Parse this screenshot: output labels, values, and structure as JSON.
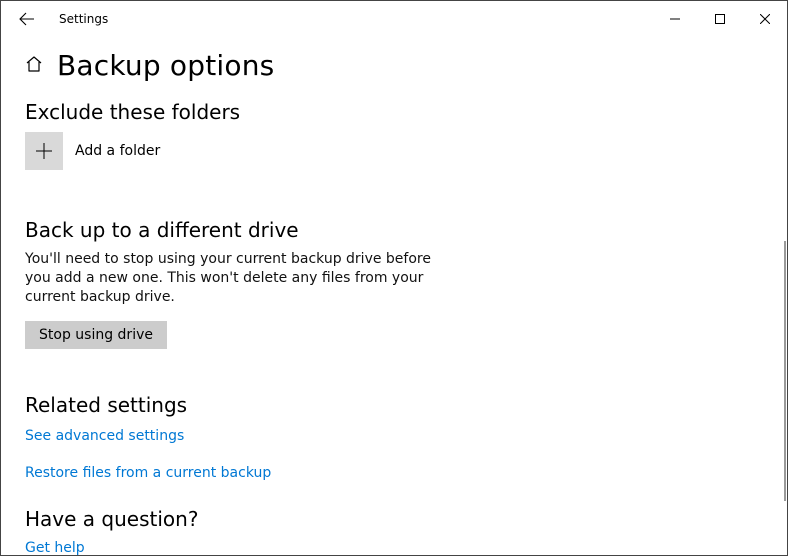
{
  "window": {
    "title": "Settings"
  },
  "page": {
    "heading": "Backup options"
  },
  "exclude": {
    "heading": "Exclude these folders",
    "add_label": "Add a folder"
  },
  "different_drive": {
    "heading": "Back up to a different drive",
    "body": "You'll need to stop using your current backup drive before you add a new one. This won't delete any files from your current backup drive.",
    "button": "Stop using drive"
  },
  "related": {
    "heading": "Related settings",
    "advanced_link": "See advanced settings",
    "restore_link": "Restore files from a current backup"
  },
  "question": {
    "heading": "Have a question?",
    "help_link": "Get help"
  }
}
